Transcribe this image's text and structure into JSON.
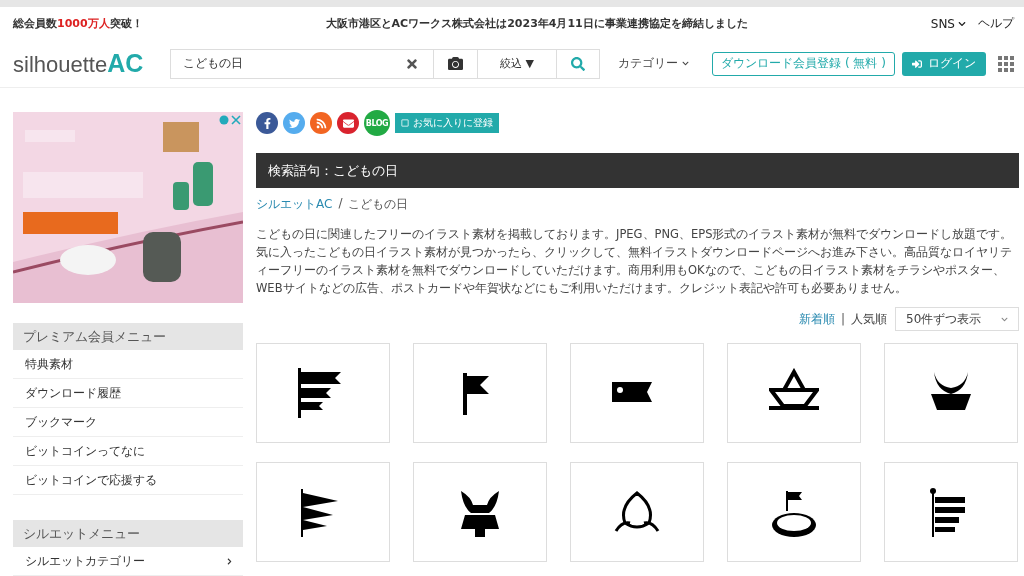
{
  "top_bar": {
    "member_count": "総会員数**1000万人**突破！",
    "notice": "大阪市港区とACワークス株式会社は2023年4月11日に事業連携協定を締結しました",
    "links": [
      "SNS",
      "ヘルプ"
    ]
  },
  "header": {
    "logo_main": "silhouette",
    "logo_accent": "AC",
    "search": {
      "value": "こどもの日"
    },
    "filter": "絞込 ▼",
    "category": "カテゴリー",
    "register": "ダウンロード会員登録 ( 無料 )",
    "login": "ログイン"
  },
  "sidebar": {
    "sections": [
      {
        "title": "プレミアム会員メニュー",
        "items": [
          {
            "label": "特典素材"
          },
          {
            "label": "ダウンロード履歴"
          },
          {
            "label": "ブックマーク"
          },
          {
            "label": "ビットコインってなに"
          },
          {
            "label": "ビットコインで応援する"
          }
        ]
      },
      {
        "title": "シルエットメニュー",
        "items": [
          {
            "label": "シルエットカテゴリー",
            "expandable": true
          }
        ]
      }
    ]
  },
  "main": {
    "share": {
      "blog": "BLOG",
      "favorite": "お気に入りに登録"
    },
    "heading": "検索語句：こどもの日",
    "breadcrumb": [
      "シルエットAC",
      "こどもの日"
    ],
    "breadcrumb_separator": "/",
    "sort_separator": "|",
    "description": "こどもの日に関連したフリーのイラスト素材を掲載しております。JPEG、PNG、EPS形式のイラスト素材が無料でダウンロードし放題です。気に入ったこどもの日イラスト素材が見つかったら、クリックして、無料イラストダウンロードページへお進み下さい。高品質なロイヤリティーフリーのイラスト素材を無料でダウンロードしていただけます。商用利用もOKなので、こどもの日イラスト素材をチラシやポスター、WEBサイトなどの広告、ポストカードや年賀状などにもご利用いただけます。クレジット表記や許可も必要ありません。",
    "sort": [
      {
        "label": "新着順",
        "selected": false
      },
      {
        "label": "人気順",
        "selected": true
      }
    ],
    "per_page": "50件ずつ表示"
  }
}
